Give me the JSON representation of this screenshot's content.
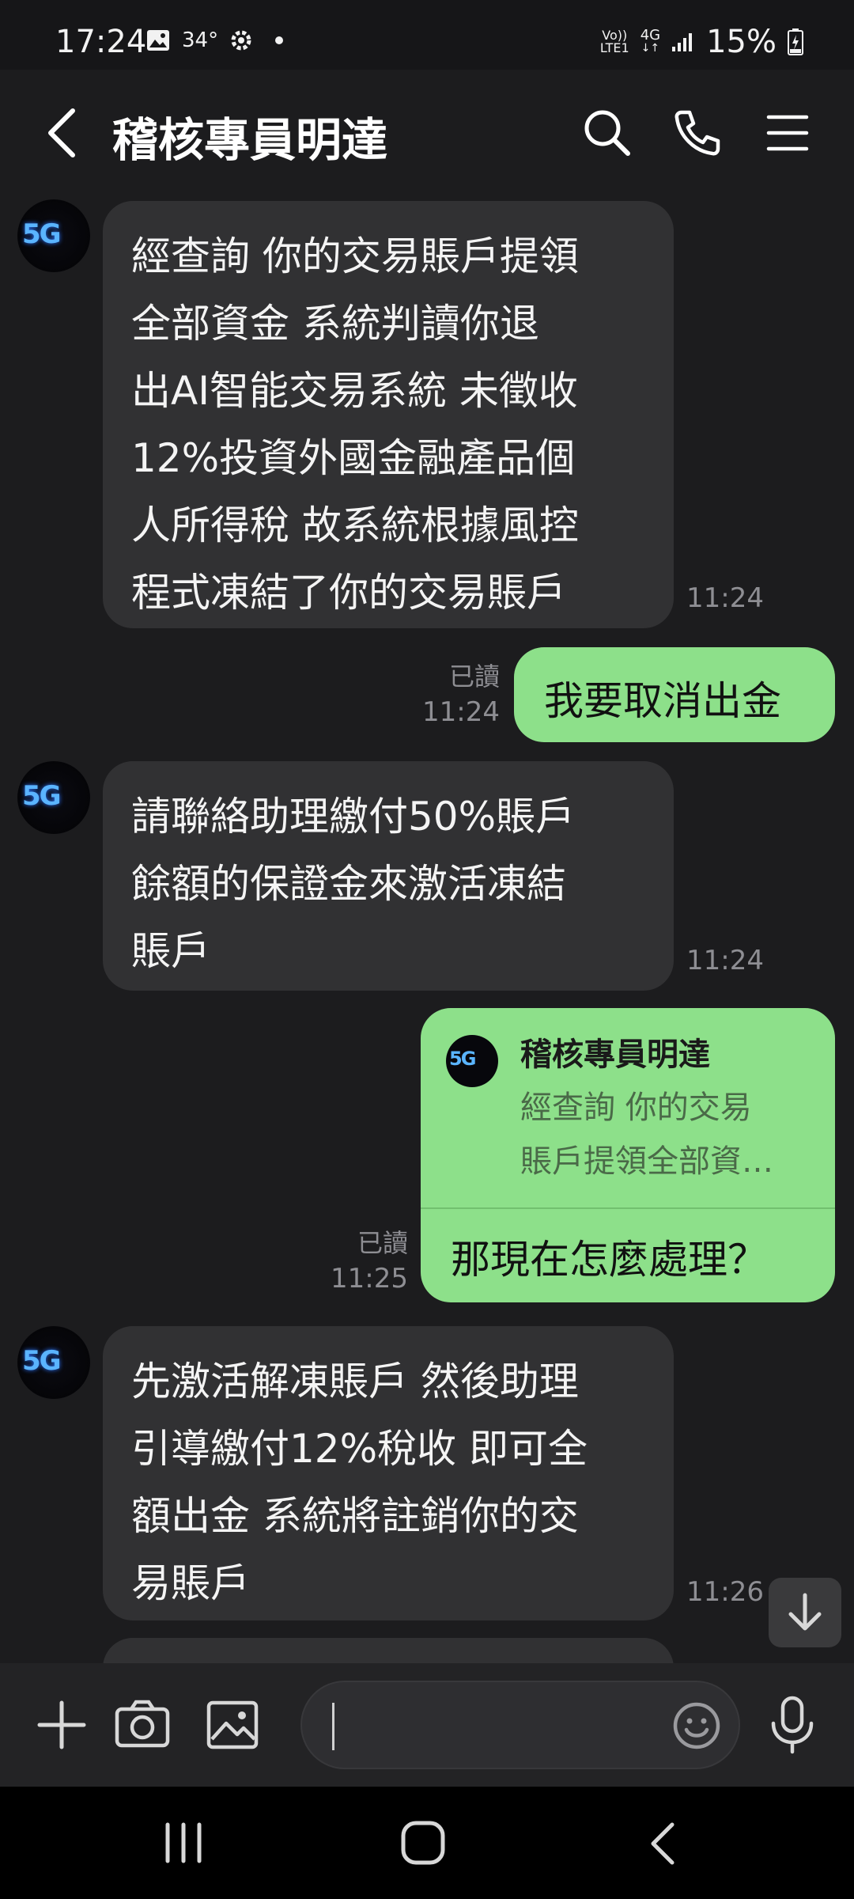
{
  "status_bar": {
    "time": "17:24",
    "temperature": "34°",
    "network_top": "Vo))",
    "network_bottom": "LTE1",
    "network_type": "4G",
    "battery": "15%"
  },
  "header": {
    "title": "稽核專員明達",
    "icons": [
      "back-icon",
      "search-icon",
      "phone-icon",
      "menu-icon"
    ]
  },
  "avatar_text": "5G",
  "messages": [
    {
      "id": "m1",
      "direction": "incoming",
      "lines": [
        "經查詢 你的交易賬戶提領",
        "全部資金 系統判讀你退",
        "出AI智能交易系統 未徵收",
        "12%投資外國金融產品個",
        "人所得稅 故系統根據風控",
        "程式凍結了你的交易賬戶"
      ],
      "time": "11:24"
    },
    {
      "id": "m2",
      "direction": "outgoing",
      "text": "我要取消出金",
      "read": "已讀",
      "time": "11:24"
    },
    {
      "id": "m3",
      "direction": "incoming",
      "lines": [
        "請聯絡助理繳付50%賬戶",
        "餘額的保證金來激活凍結",
        "賬戶"
      ],
      "time": "11:24"
    },
    {
      "id": "m4",
      "direction": "outgoing",
      "reply_sender": "稽核專員明達",
      "reply_preview_lines": [
        "經查詢 你的交易",
        "賬戶提領全部資…"
      ],
      "text": "那現在怎麼處理？",
      "read": "已讀",
      "time": "11:25"
    },
    {
      "id": "m5",
      "direction": "incoming",
      "lines": [
        "先激活解凍賬戶 然後助理",
        "引導繳付12%稅收 即可全",
        "額出金 系統將註銷你的交",
        "易賬戶"
      ],
      "time": "11:26"
    }
  ],
  "input_bar": {
    "icons": [
      "plus-icon",
      "camera-icon",
      "image-icon",
      "emoji-icon",
      "microphone-icon"
    ],
    "value": ""
  },
  "colors": {
    "background": "#1c1c1e",
    "incoming_bubble": "#313133",
    "outgoing_bubble": "#8de08a",
    "meta_text": "#8e8e93"
  }
}
